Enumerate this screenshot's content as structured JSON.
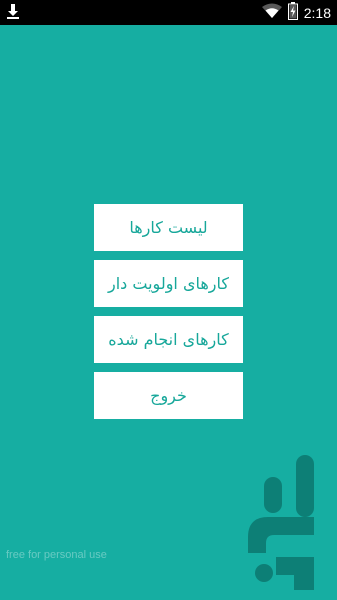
{
  "status_bar": {
    "time": "2:18",
    "icons": [
      "download-icon",
      "wifi-icon",
      "battery-charging-icon"
    ]
  },
  "menu": {
    "items": [
      {
        "label": "لیست کارها"
      },
      {
        "label": "کارهای اولویت دار"
      },
      {
        "label": "کارهای انجام شده"
      },
      {
        "label": "خروج"
      }
    ]
  },
  "watermark": "free for personal use",
  "colors": {
    "background": "#16aea2",
    "button_bg": "#ffffff",
    "button_text": "#17a79a",
    "status_bar": "#000000"
  }
}
